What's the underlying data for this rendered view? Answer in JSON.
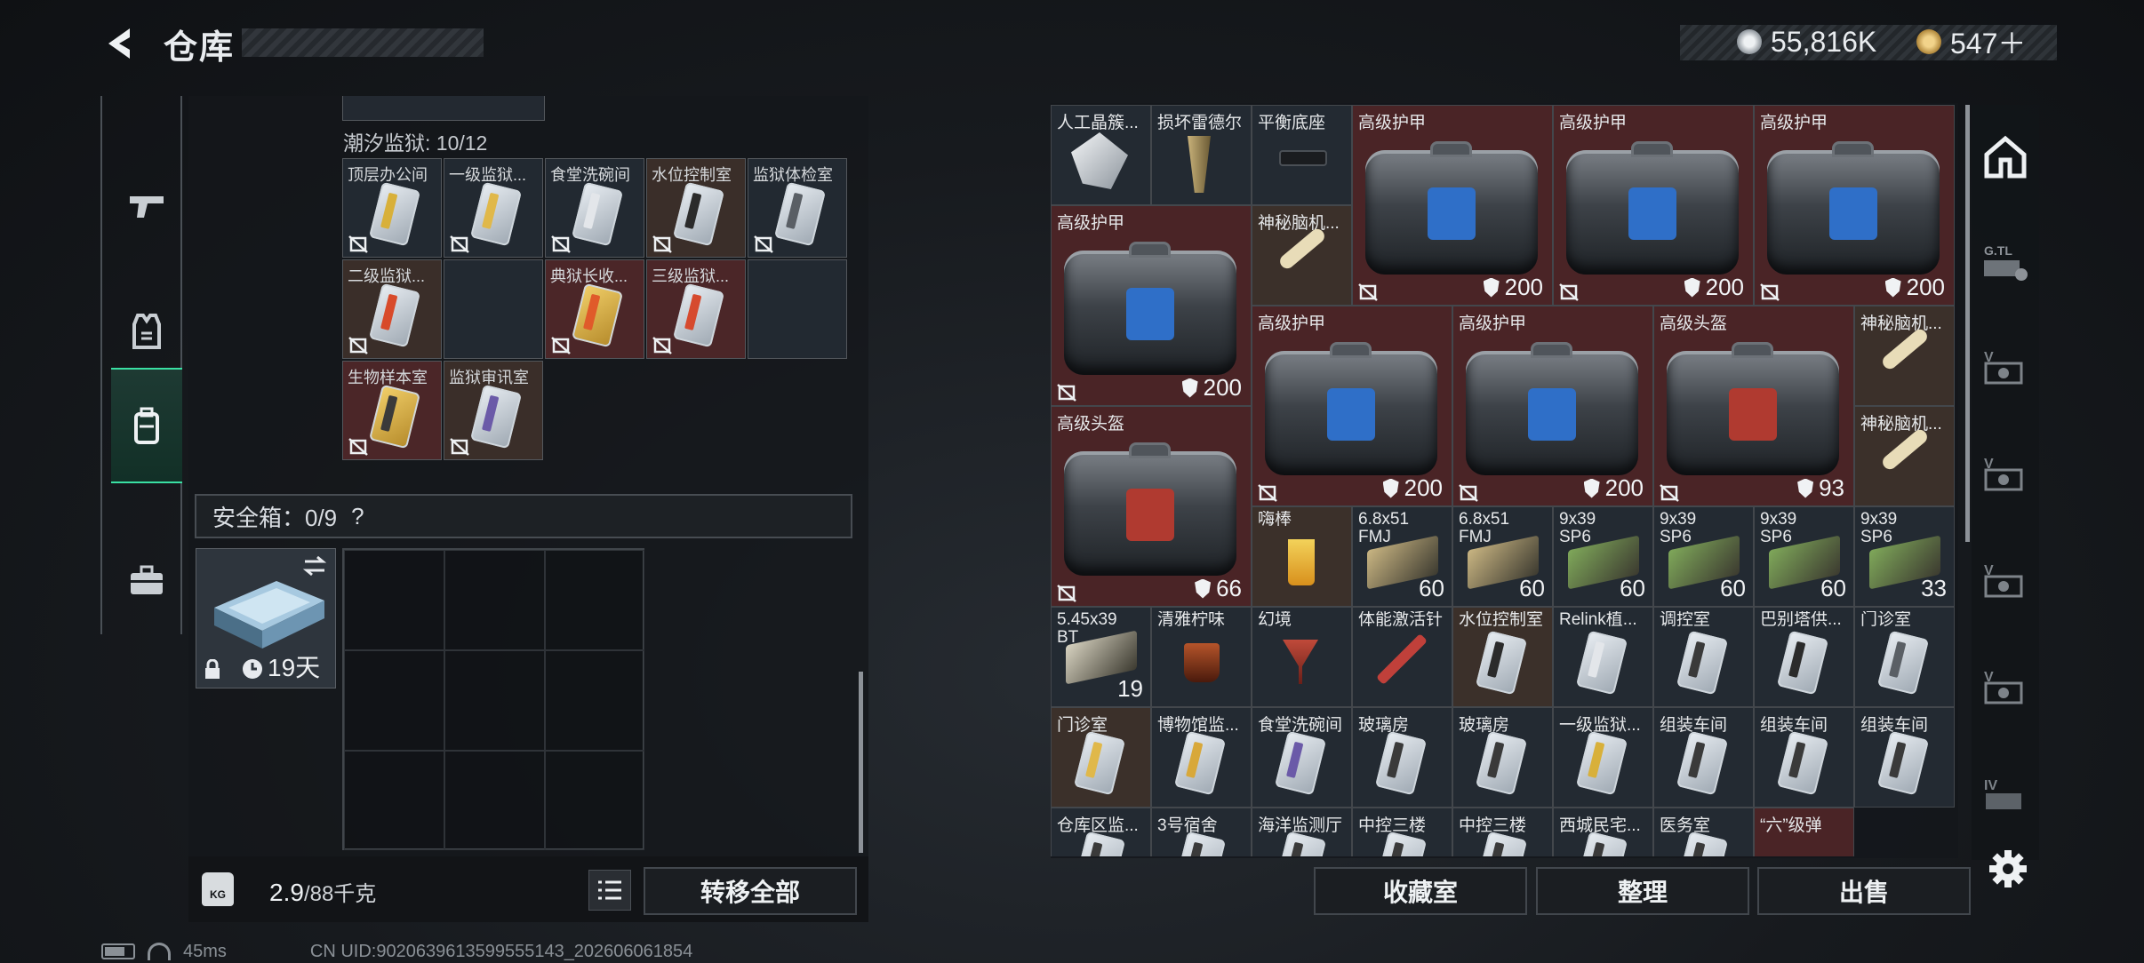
{
  "header": {
    "title": "仓库",
    "currency": {
      "silver": "55,816K",
      "gold": "547＋"
    }
  },
  "sidebar": [
    "pistol-icon",
    "armor-vest-icon",
    "backpack-icon",
    "briefcase-icon"
  ],
  "left": {
    "section_label": "潮汐监狱: 10/12",
    "keys": [
      {
        "label": "顶层办公间",
        "bg": "dark"
      },
      {
        "label": "一级监狱...",
        "bg": "dark"
      },
      {
        "label": "食堂洗碗间",
        "bg": "dark"
      },
      {
        "label": "水位控制室",
        "bg": "brown"
      },
      {
        "label": "监狱体检室",
        "bg": "dark"
      },
      {
        "label": "二级监狱...",
        "bg": "brown"
      },
      {
        "label": "",
        "bg": "empty"
      },
      {
        "label": "典狱长收...",
        "bg": "red"
      },
      {
        "label": "三级监狱...",
        "bg": "red"
      },
      {
        "label": "",
        "bg": "empty"
      },
      {
        "label": "生物样本室",
        "bg": "red"
      },
      {
        "label": "监狱审讯室",
        "bg": "brown"
      }
    ],
    "safe_label": "安全箱：0/9",
    "safe_help": "?",
    "safe_item_time": "19天",
    "weight_value": "2.9",
    "weight_max": "/88千克",
    "transfer_all": "转移全部"
  },
  "right": {
    "items": {
      "r1": [
        "人工晶簇...",
        "损坏雷德尔",
        "平衡底座"
      ],
      "armor_label": "高级护甲",
      "helmet_label": "高级头盔",
      "brain_label": "神秘脑机...",
      "dur200": "200",
      "dur93": "93",
      "dur66": "66",
      "r6": [
        {
          "label": "嗨棒",
          "count": ""
        },
        {
          "label": "6.8x51 FMJ",
          "count": "60"
        },
        {
          "label": "6.8x51 FMJ",
          "count": "60"
        },
        {
          "label": "9x39 SP6",
          "count": "60"
        },
        {
          "label": "9x39 SP6",
          "count": "60"
        },
        {
          "label": "9x39 SP6",
          "count": "60"
        },
        {
          "label": "9x39 SP6",
          "count": "33"
        }
      ],
      "r7": [
        {
          "label": "5.45x39 BT",
          "count": "19"
        },
        {
          "label": "清雅柠味",
          "count": ""
        },
        {
          "label": "幻境",
          "count": ""
        },
        {
          "label": "体能激活针",
          "count": ""
        },
        {
          "label": "水位控制室",
          "count": ""
        },
        {
          "label": "Relink植...",
          "count": ""
        },
        {
          "label": "调控室",
          "count": ""
        },
        {
          "label": "巴别塔供...",
          "count": ""
        },
        {
          "label": "门诊室",
          "count": ""
        }
      ],
      "r8": [
        "门诊室",
        "博物馆监...",
        "食堂洗碗间",
        "玻璃房",
        "玻璃房",
        "一级监狱...",
        "组装车间",
        "组装车间",
        "组装车间"
      ],
      "r9": [
        "仓库区监...",
        "3号宿舍",
        "海洋监测厅",
        "中控三楼",
        "中控三楼",
        "西城民宅...",
        "医务室",
        "“六”级弹"
      ]
    },
    "buttons": {
      "collection": "收藏室",
      "sort": "整理",
      "sell": "出售"
    }
  },
  "rightbar": [
    "home-icon",
    "g-tl-icon",
    "v-icon",
    "v-icon",
    "v-icon",
    "v-icon",
    "iv-icon",
    "settings-icon"
  ],
  "status": {
    "ping": "45ms",
    "uid": "CN UID:9020639613599555143_202606061854"
  }
}
